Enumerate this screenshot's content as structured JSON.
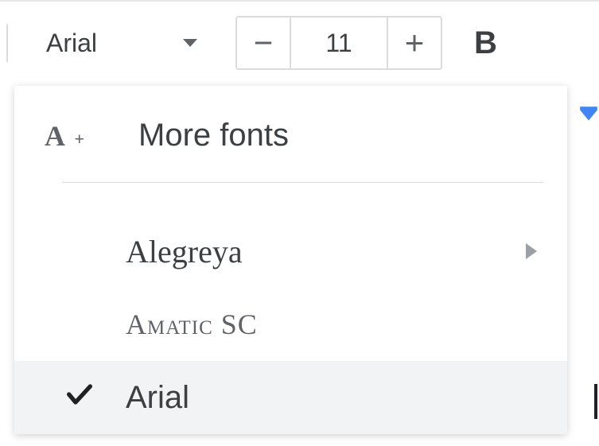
{
  "toolbar": {
    "font_selector": {
      "label": "Arial"
    },
    "font_size": {
      "value": "11",
      "decrease_label": "−",
      "increase_label": "+"
    },
    "bold_label": "B"
  },
  "font_menu": {
    "more_fonts": {
      "icon_text": "A",
      "icon_plus": "+",
      "label": "More fonts"
    },
    "items": [
      {
        "name": "Alegreya",
        "has_submenu": true,
        "checked": false,
        "family_class": "font-alegreya"
      },
      {
        "name": "Amatic SC",
        "has_submenu": false,
        "checked": false,
        "family_class": "font-amatic"
      },
      {
        "name": "Arial",
        "has_submenu": false,
        "checked": true,
        "family_class": "font-arial"
      }
    ]
  }
}
